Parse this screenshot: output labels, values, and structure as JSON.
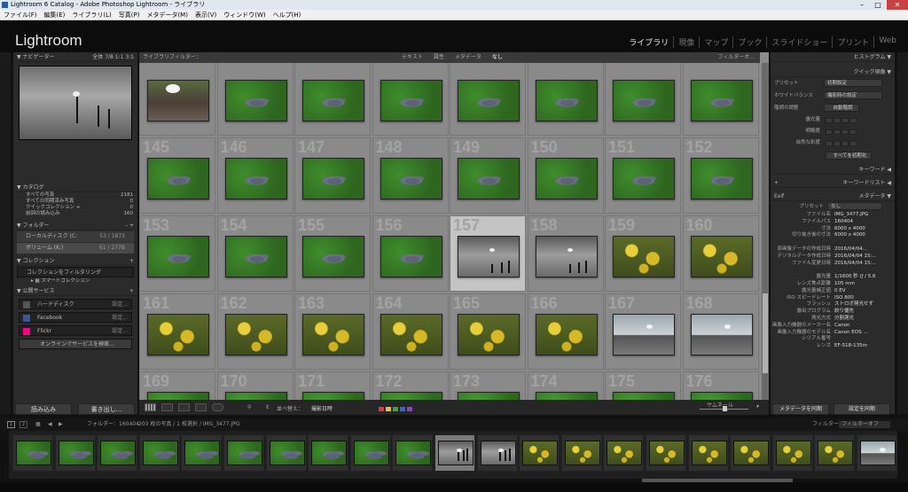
{
  "window": {
    "title": "Lightroom 6 Catalog - Adobe Photoshop Lightroom - ライブラリ"
  },
  "menu": [
    "ファイル(F)",
    "編集(E)",
    "ライブラリ(L)",
    "写真(P)",
    "メタデータ(M)",
    "表示(V)",
    "ウィンドウ(W)",
    "ヘルプ(H)"
  ],
  "brand": "Lightroom",
  "modules": [
    {
      "label": "ライブラリ",
      "active": true
    },
    {
      "label": "現像",
      "active": false
    },
    {
      "label": "マップ",
      "active": false
    },
    {
      "label": "ブック",
      "active": false
    },
    {
      "label": "スライドショー",
      "active": false
    },
    {
      "label": "プリント",
      "active": false
    },
    {
      "label": "Web",
      "active": false
    }
  ],
  "left": {
    "navigator": {
      "title": "ナビゲーター",
      "zoom": [
        "全体",
        "7/8",
        "1:1",
        "3:1"
      ]
    },
    "catalog": {
      "title": "カタログ",
      "items": [
        {
          "label": "すべての写真",
          "count": "2181"
        },
        {
          "label": "すべての同期済み写真",
          "count": "0"
        },
        {
          "label": "クイックコレクション +",
          "count": "0"
        },
        {
          "label": "前回の読み込み",
          "count": "160"
        }
      ]
    },
    "folders": {
      "title": "フォルダー",
      "items": [
        {
          "label": "ローカルディスク (C:",
          "count": "53 / 1873"
        },
        {
          "label": "ボリューム (K:)",
          "count": "61 / 277B"
        }
      ]
    },
    "collections": {
      "title": "コレクション",
      "filter": "コレクションをフィルタリング",
      "items": [
        "スマートコレクション"
      ]
    },
    "publish": {
      "title": "公開サービス",
      "items": [
        {
          "label": "ハードディスク",
          "set": "設定..."
        },
        {
          "label": "Facebook",
          "set": "設定..."
        },
        {
          "label": "Flickr",
          "set": "設定..."
        }
      ],
      "find": "オンラインでサービスを検索..."
    },
    "import_label": "読み込み",
    "export_label": "書き出し..."
  },
  "filterbar": {
    "title": "ライブラリフィルター：",
    "tabs": [
      "テキスト",
      "属性",
      "メタデータ",
      "なし"
    ],
    "right": "フィルターオ..."
  },
  "grid": {
    "rows": [
      {
        "nums": [
          "",
          "",
          "",
          "",
          "",
          "",
          "",
          ""
        ],
        "types": [
          "rocks",
          "pigeon",
          "pigeon",
          "pigeon",
          "pigeon",
          "pigeon",
          "pigeon",
          "pigeon"
        ]
      },
      {
        "nums": [
          "145",
          "146",
          "147",
          "148",
          "149",
          "150",
          "151",
          "152"
        ],
        "types": [
          "pigeon",
          "pigeon",
          "pigeon",
          "pigeon",
          "pigeon",
          "pigeon",
          "pigeon",
          "pigeon"
        ]
      },
      {
        "nums": [
          "153",
          "154",
          "155",
          "156",
          "157",
          "158",
          "159",
          "160"
        ],
        "types": [
          "pigeon",
          "pigeon",
          "pigeon",
          "pigeon",
          "water",
          "water",
          "yellow",
          "yellow"
        ]
      },
      {
        "nums": [
          "161",
          "162",
          "163",
          "164",
          "165",
          "166",
          "167",
          "168"
        ],
        "types": [
          "yellow",
          "yellow",
          "yellow",
          "yellow",
          "yellow",
          "yellow",
          "railing",
          "railing"
        ]
      },
      {
        "nums": [
          "169",
          "170",
          "171",
          "172",
          "173",
          "174",
          "175",
          "176"
        ],
        "types": [
          "grass",
          "grass",
          "grass",
          "grass",
          "grass",
          "grass",
          "grass",
          "grass"
        ]
      }
    ],
    "selected": "157"
  },
  "toolbar": {
    "sort_label": "並べ替え：",
    "sort_value": "撮影日時",
    "thumb_label": "サムネール",
    "colors": [
      "#d93b3b",
      "#e0c43a",
      "#3fa540",
      "#3a62d6",
      "#8b45c9"
    ]
  },
  "right": {
    "histogram": "ヒストグラム",
    "quick": {
      "title": "クイック現像",
      "preset_label": "プリセット",
      "preset_value": "初期設定",
      "wb_label": "ホワイトバランス",
      "wb_value": "撮影時の設定",
      "tone_label": "階調の調整",
      "tone_value": "自動階調",
      "rows": [
        "露光量",
        "明瞭度",
        "自然な彩度"
      ],
      "reset": "すべてを初期化"
    },
    "keyword": "キーワード",
    "keywordlist": "キーワードリスト",
    "metadata": {
      "exif": "Exif",
      "title": "メタデータ",
      "preset_label": "プリセット",
      "preset_value": "なし",
      "fields": [
        {
          "l": "ファイル名",
          "v": "IMG_3477.JPG"
        },
        {
          "l": "ファイルパス",
          "v": "160404"
        },
        {
          "l": "寸法",
          "v": "6000 x 4000"
        },
        {
          "l": "切り抜き後の寸法",
          "v": "6000 x 4000"
        },
        {
          "l": "",
          "v": ""
        },
        {
          "l": "原画像データの作成日時",
          "v": "2016/04/04..."
        },
        {
          "l": "デジタルデータ作成日時",
          "v": "2016/04/04 15:..."
        },
        {
          "l": "ファイル変更日時",
          "v": "2016/04/04 15:..."
        },
        {
          "l": "",
          "v": ""
        },
        {
          "l": "露光量",
          "v": "1/1600 秒 (ƒ / 5.6"
        },
        {
          "l": "レンズ焦点距離",
          "v": "105 mm"
        },
        {
          "l": "露光量補正値",
          "v": "0 EV"
        },
        {
          "l": "ISO スピードレート",
          "v": "ISO 800"
        },
        {
          "l": "フラッシュ",
          "v": "ストロボ発光せず"
        },
        {
          "l": "露出プログラム",
          "v": "絞り優先"
        },
        {
          "l": "測光方式",
          "v": "分割測光"
        },
        {
          "l": "画像入力機器のメーカー名",
          "v": "Canon"
        },
        {
          "l": "画像入力機器のモデル名",
          "v": "Canon EOS ..."
        },
        {
          "l": "シリアル番号",
          "v": ""
        },
        {
          "l": "レンズ",
          "v": "EF-S18-135m"
        }
      ]
    },
    "sync_meta": "メタデータを同期",
    "sync_settings": "設定を同期"
  },
  "filmbar": {
    "folder_label": "フォルダー：160404",
    "count": "203 枚の写真 / 1 枚選択 / IMG_3477.JPG",
    "filter_label": "フィルター：",
    "filter_value": "フィルターオフ"
  },
  "film": [
    "pigeon",
    "pigeon",
    "pigeon",
    "pigeon",
    "pigeon",
    "pigeon",
    "pigeon",
    "pigeon",
    "pigeon",
    "pigeon",
    "water",
    "water",
    "yellow",
    "yellow",
    "yellow",
    "yellow",
    "yellow",
    "yellow",
    "yellow",
    "yellow",
    "railing"
  ],
  "film_selected": 10
}
